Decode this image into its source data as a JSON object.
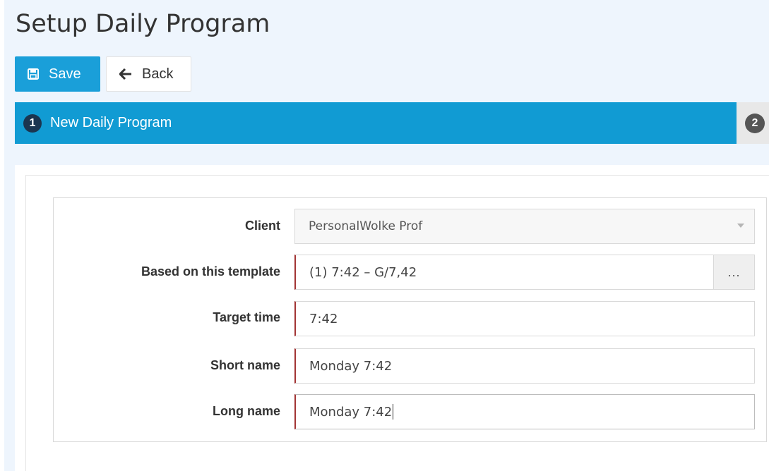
{
  "page": {
    "title": "Setup Daily Program"
  },
  "toolbar": {
    "save_label": "Save",
    "back_label": "Back"
  },
  "wizard": {
    "steps": [
      {
        "number": "1",
        "label": "New Daily Program",
        "active": true
      },
      {
        "number": "2",
        "label": "",
        "active": false
      }
    ]
  },
  "form": {
    "client": {
      "label": "Client",
      "value": "PersonalWolke Prof"
    },
    "template": {
      "label": "Based on this template",
      "value": "(1) 7:42 – G/7,42",
      "picker_label": "..."
    },
    "target_time": {
      "label": "Target time",
      "value": "7:42"
    },
    "short_name": {
      "label": "Short name",
      "value": "Monday 7:42"
    },
    "long_name": {
      "label": "Long name",
      "value": "Monday 7:42"
    }
  },
  "colors": {
    "accent": "#1a9fd9",
    "wizard_bar": "#119bd3",
    "required_marker": "#a23434",
    "page_background": "#eef5fd"
  }
}
